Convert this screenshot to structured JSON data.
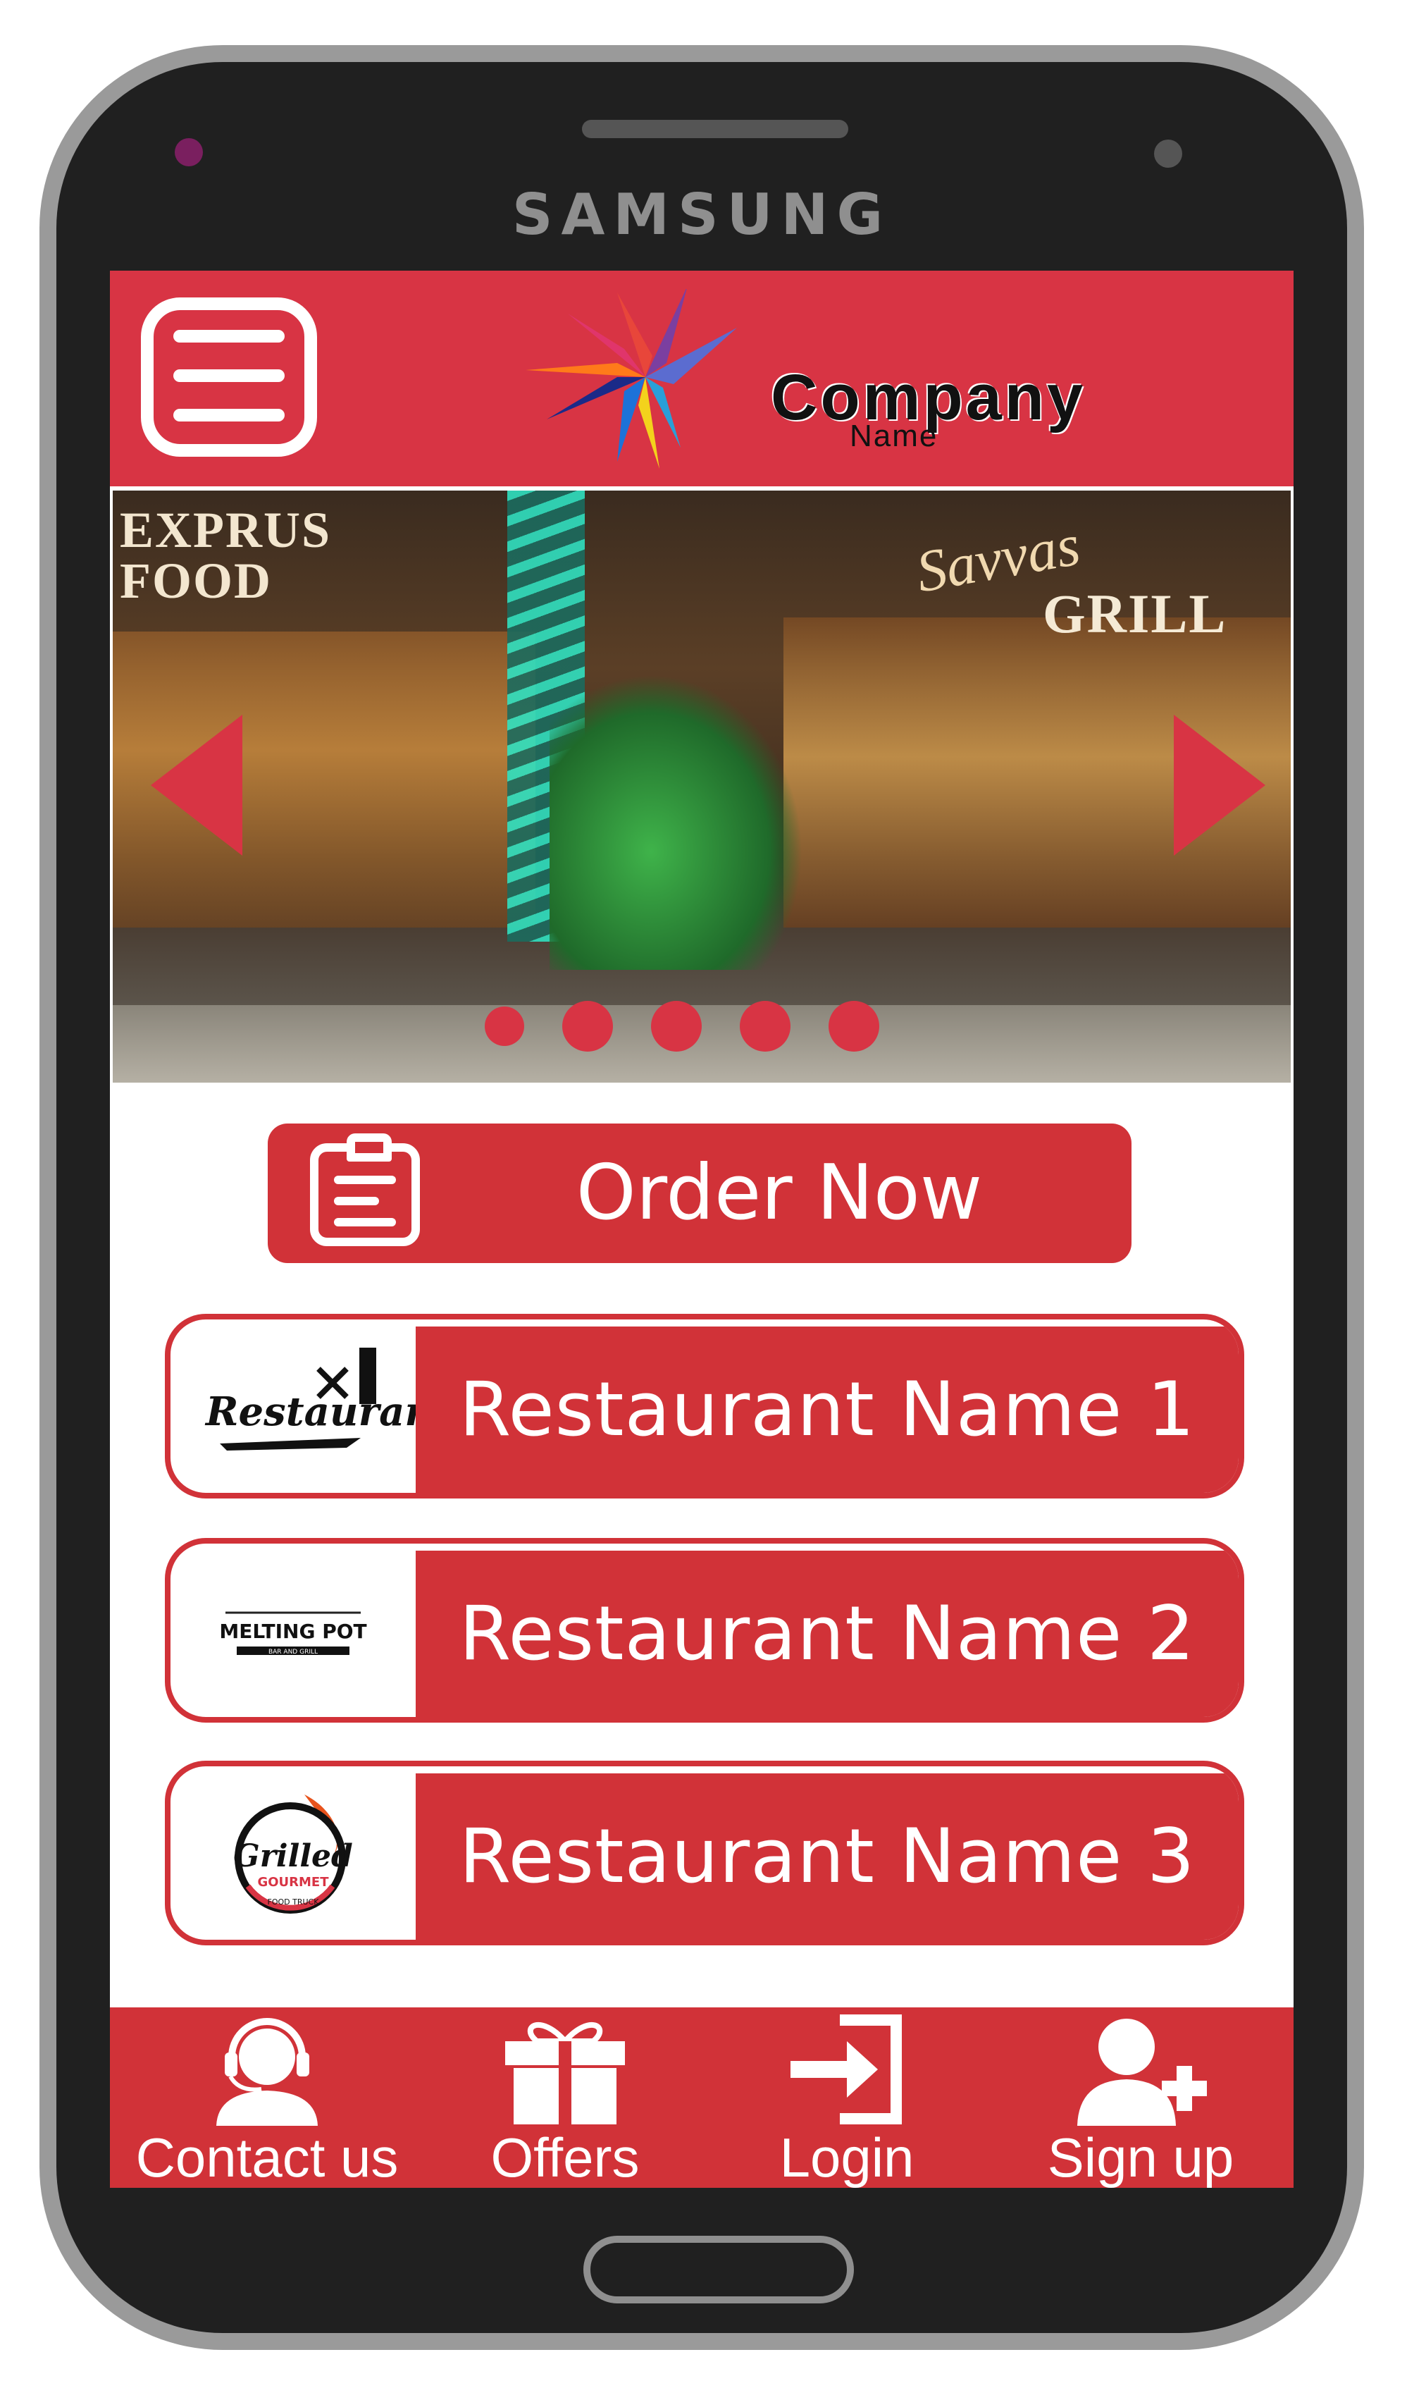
{
  "device": {
    "brand": "SAMSUNG"
  },
  "header": {
    "logo_name": "Company",
    "logo_sub": "Name",
    "colors": {
      "bar": "#d83444"
    }
  },
  "carousel": {
    "sign_left": "EXPRUS FOOD",
    "sign_right_script": "Savvas",
    "sign_right_block": "GRILL",
    "slide_count": 5
  },
  "order": {
    "label": "Order Now",
    "icon": "clipboard-icon"
  },
  "restaurants": [
    {
      "label": "Restaurant Name 1",
      "logo_text": "Restaurant"
    },
    {
      "label": "Restaurant Name 2",
      "logo_text": "MELTING POT",
      "logo_sub": "BAR AND GRILL"
    },
    {
      "label": "Restaurant Name 3",
      "logo_text": "Grilled",
      "logo_sub": "GOURMET",
      "logo_sub2": "FOOD TRUCK"
    }
  ],
  "bottom_nav": [
    {
      "label": "Contact us",
      "icon": "headset-user-icon"
    },
    {
      "label": "Offers",
      "icon": "gift-icon"
    },
    {
      "label": "Login",
      "icon": "login-icon"
    },
    {
      "label": "Sign up",
      "icon": "add-user-icon"
    }
  ],
  "colors": {
    "accent": "#d13238",
    "header": "#d83444",
    "phone_body": "#202020",
    "phone_frame": "#9a9a9a"
  }
}
